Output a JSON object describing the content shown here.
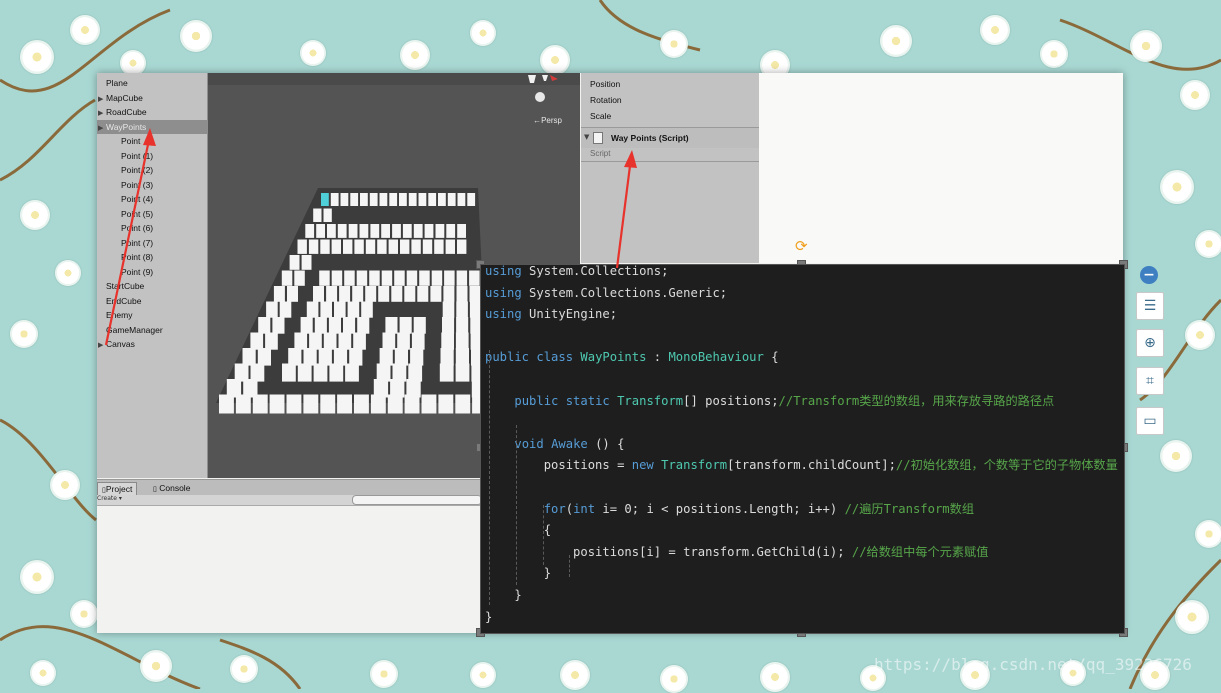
{
  "hierarchy": {
    "items": [
      {
        "label": "Plane",
        "indent": 0,
        "expandable": false
      },
      {
        "label": "MapCube",
        "indent": 0,
        "expandable": true
      },
      {
        "label": "RoadCube",
        "indent": 0,
        "expandable": true
      },
      {
        "label": "WayPoints",
        "indent": 0,
        "expandable": true,
        "selected": true
      },
      {
        "label": "Point",
        "indent": 1,
        "expandable": false
      },
      {
        "label": "Point (1)",
        "indent": 1,
        "expandable": false
      },
      {
        "label": "Point (2)",
        "indent": 1,
        "expandable": false
      },
      {
        "label": "Point (3)",
        "indent": 1,
        "expandable": false
      },
      {
        "label": "Point (4)",
        "indent": 1,
        "expandable": false
      },
      {
        "label": "Point (5)",
        "indent": 1,
        "expandable": false
      },
      {
        "label": "Point (6)",
        "indent": 1,
        "expandable": false
      },
      {
        "label": "Point (7)",
        "indent": 1,
        "expandable": false
      },
      {
        "label": "Point (8)",
        "indent": 1,
        "expandable": false
      },
      {
        "label": "Point (9)",
        "indent": 1,
        "expandable": false
      },
      {
        "label": "StartCube",
        "indent": 0,
        "expandable": false
      },
      {
        "label": "EndCube",
        "indent": 0,
        "expandable": false
      },
      {
        "label": "Enemy",
        "indent": 0,
        "expandable": false
      },
      {
        "label": "GameManager",
        "indent": 0,
        "expandable": false
      },
      {
        "label": "Canvas",
        "indent": 0,
        "expandable": true
      }
    ]
  },
  "scene": {
    "persp_label": "←Persp"
  },
  "inspector": {
    "position_label": "Position",
    "rotation_label": "Rotation",
    "scale_label": "Scale",
    "component_title": "Way Points (Script)",
    "script_label": "Script"
  },
  "project_panel": {
    "tab_project": "Project",
    "tab_console": "Console",
    "create_label": "Create ▾"
  },
  "code": {
    "lines": [
      {
        "parts": [
          {
            "t": "using",
            "c": "kw"
          },
          {
            "t": " System.Collections;"
          }
        ]
      },
      {
        "parts": [
          {
            "t": "using",
            "c": "kw"
          },
          {
            "t": " System.Collections.Generic;"
          }
        ]
      },
      {
        "parts": [
          {
            "t": "using",
            "c": "kw"
          },
          {
            "t": " UnityEngine;"
          }
        ]
      },
      {
        "parts": []
      },
      {
        "parts": [
          {
            "t": "public class",
            "c": "kw"
          },
          {
            "t": " "
          },
          {
            "t": "WayPoints",
            "c": "ty"
          },
          {
            "t": " : "
          },
          {
            "t": "MonoBehaviour",
            "c": "ty"
          },
          {
            "t": " {"
          }
        ]
      },
      {
        "parts": []
      },
      {
        "parts": [
          {
            "t": "    "
          },
          {
            "t": "public static",
            "c": "kw"
          },
          {
            "t": " "
          },
          {
            "t": "Transform",
            "c": "ty"
          },
          {
            "t": "[] positions;"
          },
          {
            "t": "//Transform类型的数组，用来存放寻路的路径点",
            "c": "cm"
          }
        ]
      },
      {
        "parts": []
      },
      {
        "parts": [
          {
            "t": "    "
          },
          {
            "t": "void",
            "c": "kw"
          },
          {
            "t": " "
          },
          {
            "t": "Awake",
            "c": "kw"
          },
          {
            "t": " () {"
          }
        ]
      },
      {
        "parts": [
          {
            "t": "        positions = "
          },
          {
            "t": "new",
            "c": "kw"
          },
          {
            "t": " "
          },
          {
            "t": "Transform",
            "c": "ty"
          },
          {
            "t": "[transform.childCount];"
          },
          {
            "t": "//初始化数组，个数等于它的子物体数量",
            "c": "cm"
          }
        ]
      },
      {
        "parts": []
      },
      {
        "parts": [
          {
            "t": "        "
          },
          {
            "t": "for",
            "c": "kw"
          },
          {
            "t": "("
          },
          {
            "t": "int",
            "c": "kw"
          },
          {
            "t": " i= 0; i < positions.Length; i++) "
          },
          {
            "t": "//遍历Transform数组",
            "c": "cm"
          }
        ]
      },
      {
        "parts": [
          {
            "t": "        {"
          }
        ]
      },
      {
        "parts": [
          {
            "t": "            positions[i] = transform.GetChild(i); "
          },
          {
            "t": "//给数组中每个元素赋值",
            "c": "cm"
          }
        ]
      },
      {
        "parts": [
          {
            "t": "        }"
          }
        ]
      },
      {
        "parts": [
          {
            "t": "    }"
          }
        ]
      },
      {
        "parts": [
          {
            "t": "}"
          }
        ]
      }
    ]
  },
  "toolbar": {
    "buttons": [
      {
        "name": "collapse-button",
        "icon": "minus-circle-icon",
        "glyph": "−"
      },
      {
        "name": "layers-button",
        "icon": "layers-icon",
        "glyph": "☰"
      },
      {
        "name": "zoom-in-button",
        "icon": "zoom-in-icon",
        "glyph": "⊕"
      },
      {
        "name": "crop-button",
        "icon": "crop-icon",
        "glyph": "⌗"
      },
      {
        "name": "screen-button",
        "icon": "screen-icon",
        "glyph": "▭"
      }
    ]
  },
  "watermark": {
    "text": "https://blog.csdn.net/qq_39236726"
  },
  "colors": {
    "background": "#a9d8d3",
    "annotation_arrow": "#e8322c",
    "code_background": "#1e1e1e",
    "keyword": "#569cd6",
    "type": "#4ec9b0",
    "comment": "#57a64a"
  }
}
